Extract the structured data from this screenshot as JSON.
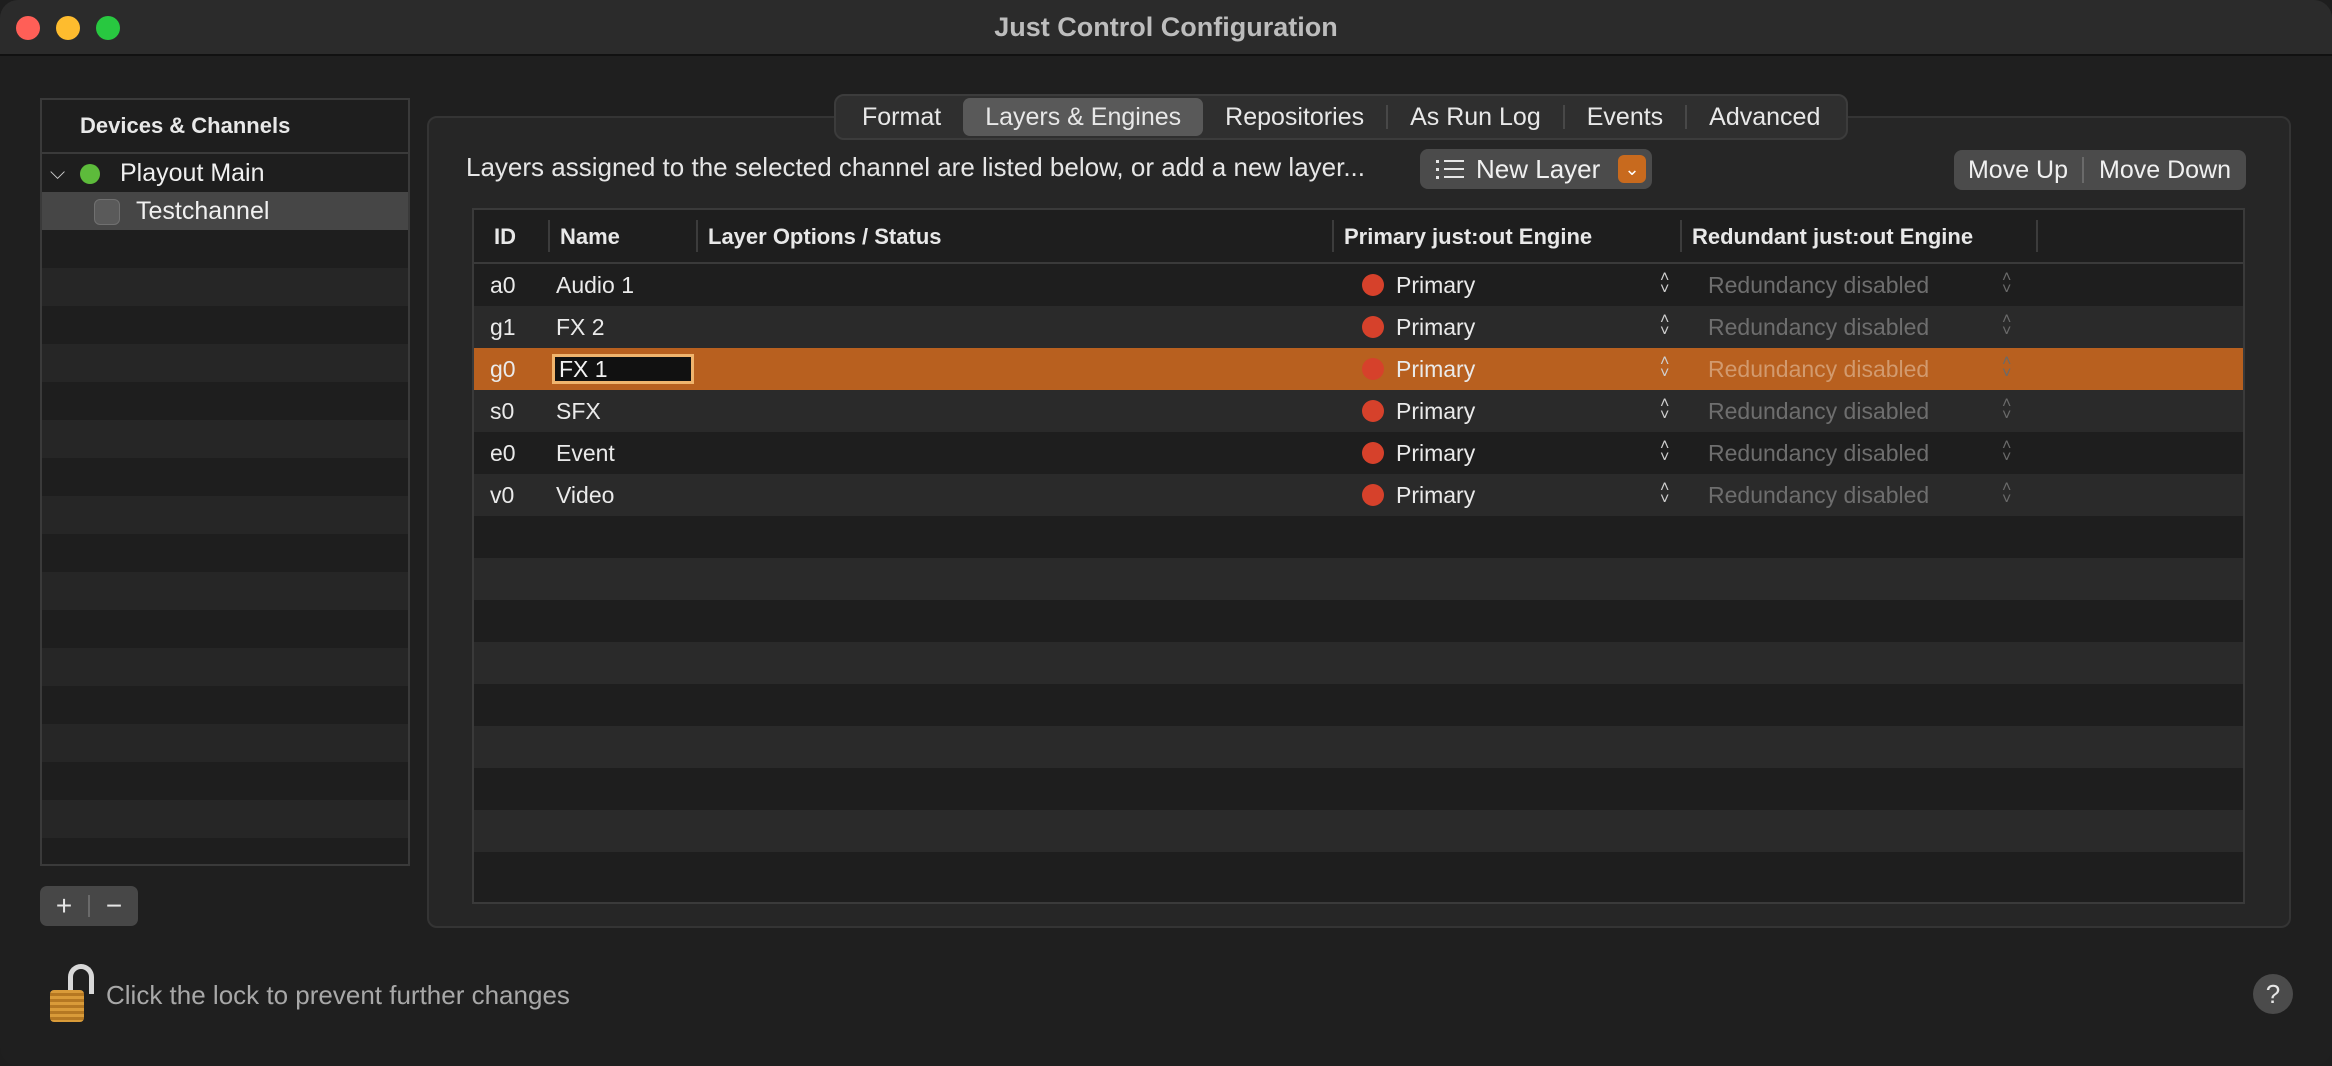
{
  "window": {
    "title": "Just Control Configuration"
  },
  "sidebar": {
    "header": "Devices & Channels",
    "items": [
      {
        "label": "Playout Main",
        "status_color": "#5dbb3b",
        "expanded": true
      },
      {
        "label": "Testchannel",
        "checked": false,
        "selected": true
      }
    ],
    "add_label": "+",
    "remove_label": "−"
  },
  "tabs": [
    {
      "label": "Format"
    },
    {
      "label": "Layers & Engines",
      "active": true
    },
    {
      "label": "Repositories"
    },
    {
      "label": "As Run Log"
    },
    {
      "label": "Events"
    },
    {
      "label": "Advanced"
    }
  ],
  "main": {
    "intro": "Layers assigned to the selected channel are listed below, or add a new layer...",
    "new_layer_label": "New Layer",
    "move_up_label": "Move Up",
    "move_down_label": "Move Down"
  },
  "table": {
    "columns": [
      "ID",
      "Name",
      "Layer Options / Status",
      "Primary just:out Engine",
      "Redundant just:out Engine"
    ],
    "rows": [
      {
        "id": "a0",
        "name": "Audio 1",
        "primary": "Primary",
        "redundant": "Redundancy disabled"
      },
      {
        "id": "g1",
        "name": "FX 2",
        "primary": "Primary",
        "redundant": "Redundancy disabled"
      },
      {
        "id": "g0",
        "name": "FX 1",
        "primary": "Primary",
        "redundant": "Redundancy disabled",
        "selected": true,
        "editing": true
      },
      {
        "id": "s0",
        "name": "SFX",
        "primary": "Primary",
        "redundant": "Redundancy disabled"
      },
      {
        "id": "e0",
        "name": "Event",
        "primary": "Primary",
        "redundant": "Redundancy disabled"
      },
      {
        "id": "v0",
        "name": "Video",
        "primary": "Primary",
        "redundant": "Redundancy disabled"
      }
    ]
  },
  "footer": {
    "lock_message": "Click the lock to prevent further changes",
    "help_label": "?"
  },
  "colors": {
    "accent": "#b8601f",
    "status_primary": "#d6412b",
    "status_online": "#5dbb3b"
  }
}
